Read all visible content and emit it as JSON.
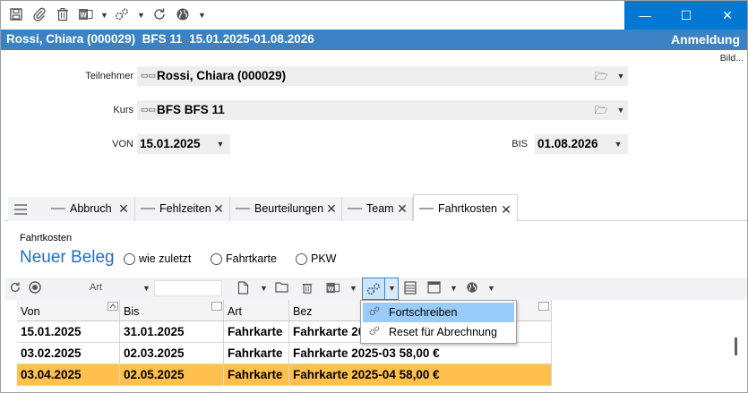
{
  "toolbar": {
    "icons": [
      "save-icon",
      "attach-icon",
      "delete-icon",
      "word-icon",
      "gears-icon",
      "refresh-icon",
      "globe-icon"
    ]
  },
  "window": {
    "title": "Rossi, Chiara (000029)  BFS 11  15.01.2025-01.08.2026",
    "mode": "Anmeldung",
    "minimize_glyph": "—",
    "maximize_glyph": "☐",
    "close_glyph": "✕"
  },
  "bild_link": "Bild...",
  "form": {
    "teilnehmer_label": "Teilnehmer",
    "teilnehmer_value": "Rossi, Chiara (000029)",
    "kurs_label": "Kurs",
    "kurs_value": "BFS BFS 11",
    "von_label": "VON",
    "von_value": "15.01.2025",
    "bis_label": "BIS",
    "bis_value": "01.08.2026"
  },
  "tabs": [
    {
      "label": "Abbruch"
    },
    {
      "label": "Fehlzeiten"
    },
    {
      "label": "Beurteilungen"
    },
    {
      "label": "Team"
    },
    {
      "label": "Fahrtkosten",
      "active": true
    }
  ],
  "section": {
    "caption": "Fahrtkosten",
    "new_entry": "Neuer Beleg",
    "radios": [
      "wie zuletzt",
      "Fahrtkarte",
      "PKW"
    ]
  },
  "grid_toolbar": {
    "art_label": "Art"
  },
  "table": {
    "columns": [
      "Von",
      "Bis",
      "Art",
      "Bez"
    ],
    "rows": [
      [
        "15.01.2025",
        "31.01.2025",
        "Fahrkarte",
        "Fahrkarte 20"
      ],
      [
        "03.02.2025",
        "02.03.2025",
        "Fahrkarte",
        "Fahrkarte 2025-03 58,00 €"
      ],
      [
        "03.04.2025",
        "02.05.2025",
        "Fahrkarte",
        "Fahrkarte 2025-04 58,00 €"
      ]
    ],
    "selected_row": 2,
    "selected_color": "#ffc04d"
  },
  "context_menu": {
    "items": [
      "Fortschreiben",
      "Reset für Abrechnung"
    ],
    "hover_index": 0
  },
  "colors": {
    "accent": "#0078d4",
    "header_bar": "#3a82c4",
    "link_blue": "#1e6fc8"
  }
}
